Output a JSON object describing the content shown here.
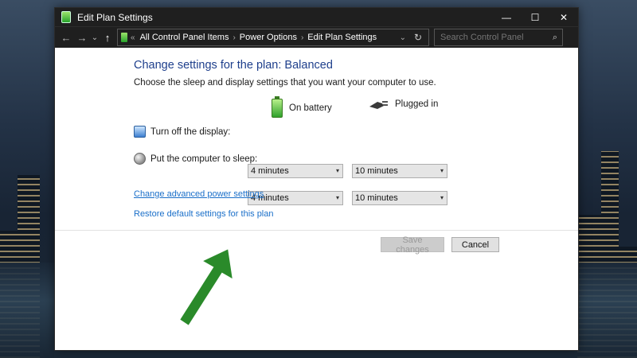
{
  "window": {
    "title": "Edit Plan Settings",
    "controls": {
      "minimize": "—",
      "maximize": "☐",
      "close": "✕"
    }
  },
  "address_bar": {
    "back": "←",
    "forward": "→",
    "recent": "⌄",
    "up": "↑",
    "overflow": "«",
    "breadcrumbs": [
      "All Control Panel Items",
      "Power Options",
      "Edit Plan Settings"
    ],
    "separator": "›",
    "dropdown": "⌄",
    "refresh": "↻",
    "search_placeholder": "Search Control Panel",
    "search_icon": "⌕"
  },
  "main": {
    "heading": "Change settings for the plan: Balanced",
    "subtext": "Choose the sleep and display settings that you want your computer to use.",
    "columns": {
      "on_battery": {
        "label": "On battery",
        "icon": "battery-icon"
      },
      "plugged_in": {
        "label": "Plugged in",
        "icon": "plug-icon"
      }
    },
    "settings": [
      {
        "label": "Turn off the display:",
        "icon": "monitor-icon",
        "on_battery": "4 minutes",
        "plugged_in": "10 minutes"
      },
      {
        "label": "Put the computer to sleep:",
        "icon": "moon-icon",
        "on_battery": "4 minutes",
        "plugged_in": "10 minutes"
      }
    ],
    "caret": "▾",
    "links": {
      "advanced": "Change advanced power settings",
      "restore": "Restore default settings for this plan"
    }
  },
  "footer": {
    "save": "Save changes",
    "cancel": "Cancel"
  },
  "colors": {
    "heading": "#1e3f8c",
    "link": "#1a6fc9",
    "titlebar": "#1f1f1f",
    "arrow": "#2a8a2a"
  }
}
